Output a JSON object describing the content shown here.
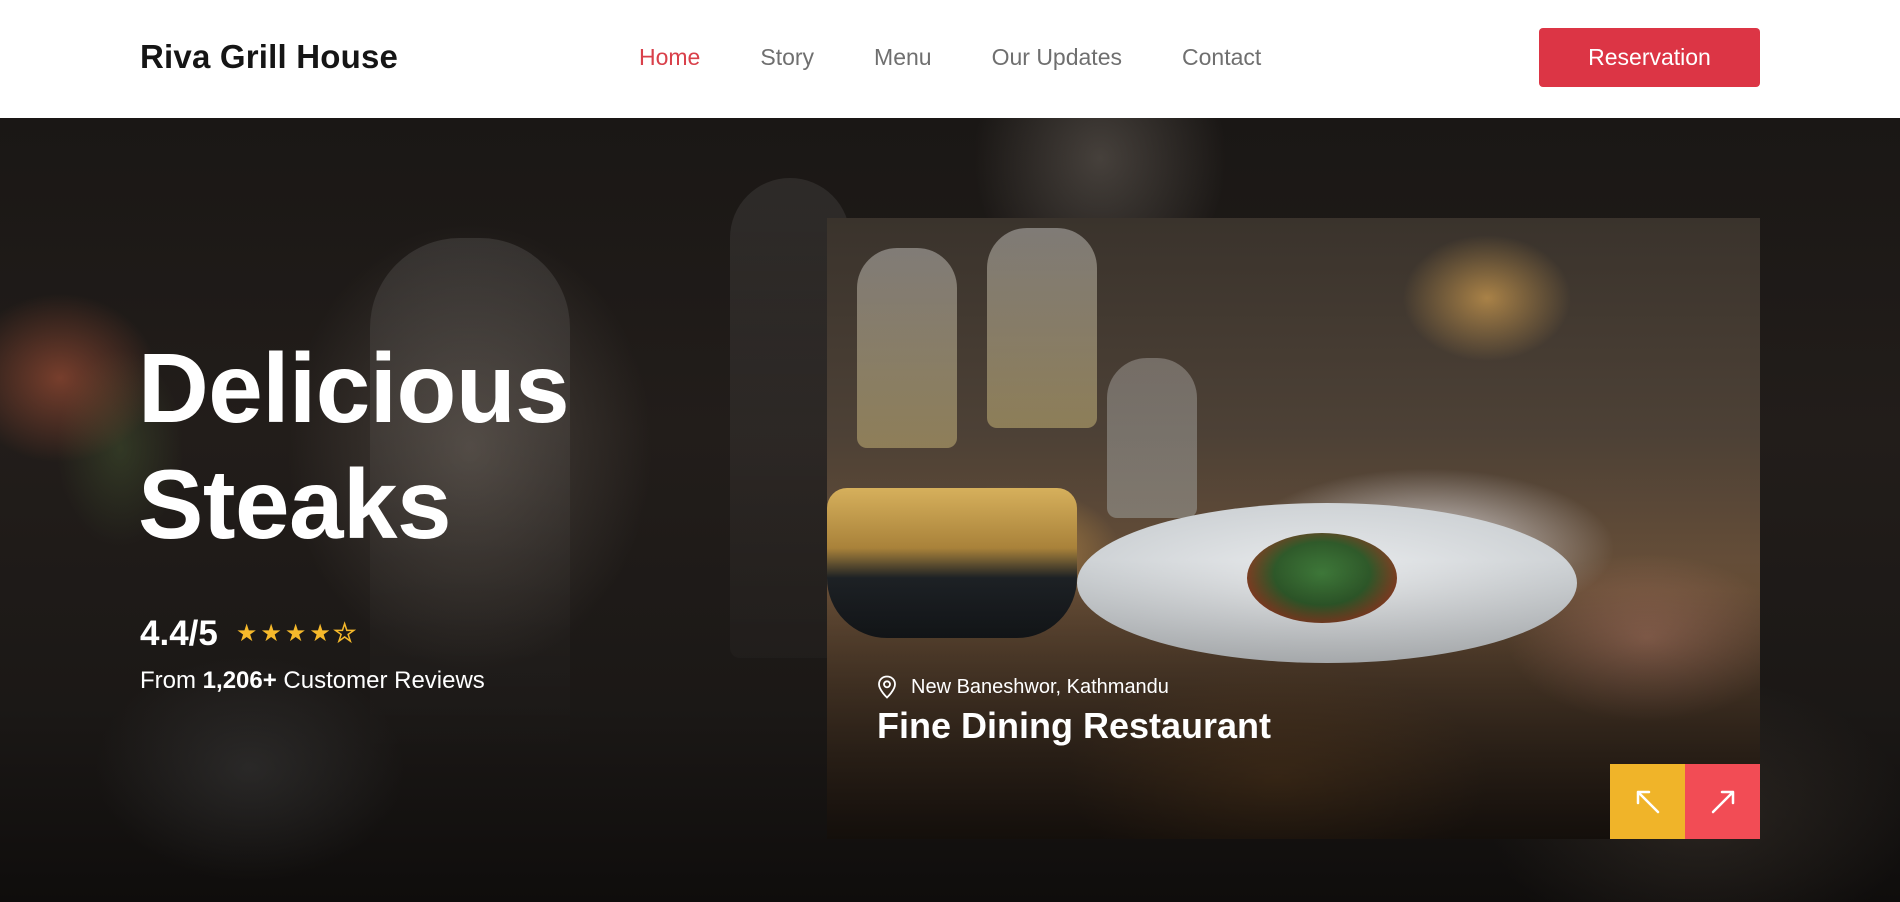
{
  "header": {
    "brand": "Riva Grill House",
    "nav": [
      {
        "label": "Home",
        "active": true
      },
      {
        "label": "Story",
        "active": false
      },
      {
        "label": "Menu",
        "active": false
      },
      {
        "label": "Our Updates",
        "active": false
      },
      {
        "label": "Contact",
        "active": false
      }
    ],
    "reservation_label": "Reservation"
  },
  "hero": {
    "title_line1": "Delicious",
    "title_line2": "Steaks",
    "rating": "4.4/5",
    "stars": {
      "filled": 4,
      "total": 5
    },
    "reviews_prefix": "From",
    "reviews_count": "1,206+",
    "reviews_suffix": "Customer Reviews"
  },
  "feature_card": {
    "location": "New Baneshwor, Kathmandu",
    "title": "Fine Dining Restaurant",
    "icons": {
      "location": "map-pin-icon",
      "prev": "arrow-up-left-icon",
      "next": "arrow-up-right-icon"
    }
  },
  "colors": {
    "accent_red": "#dc3545",
    "active_nav": "#d9404a",
    "star_yellow": "#f6b92b",
    "prev_button": "#f0b429",
    "next_button": "#f24c55"
  }
}
